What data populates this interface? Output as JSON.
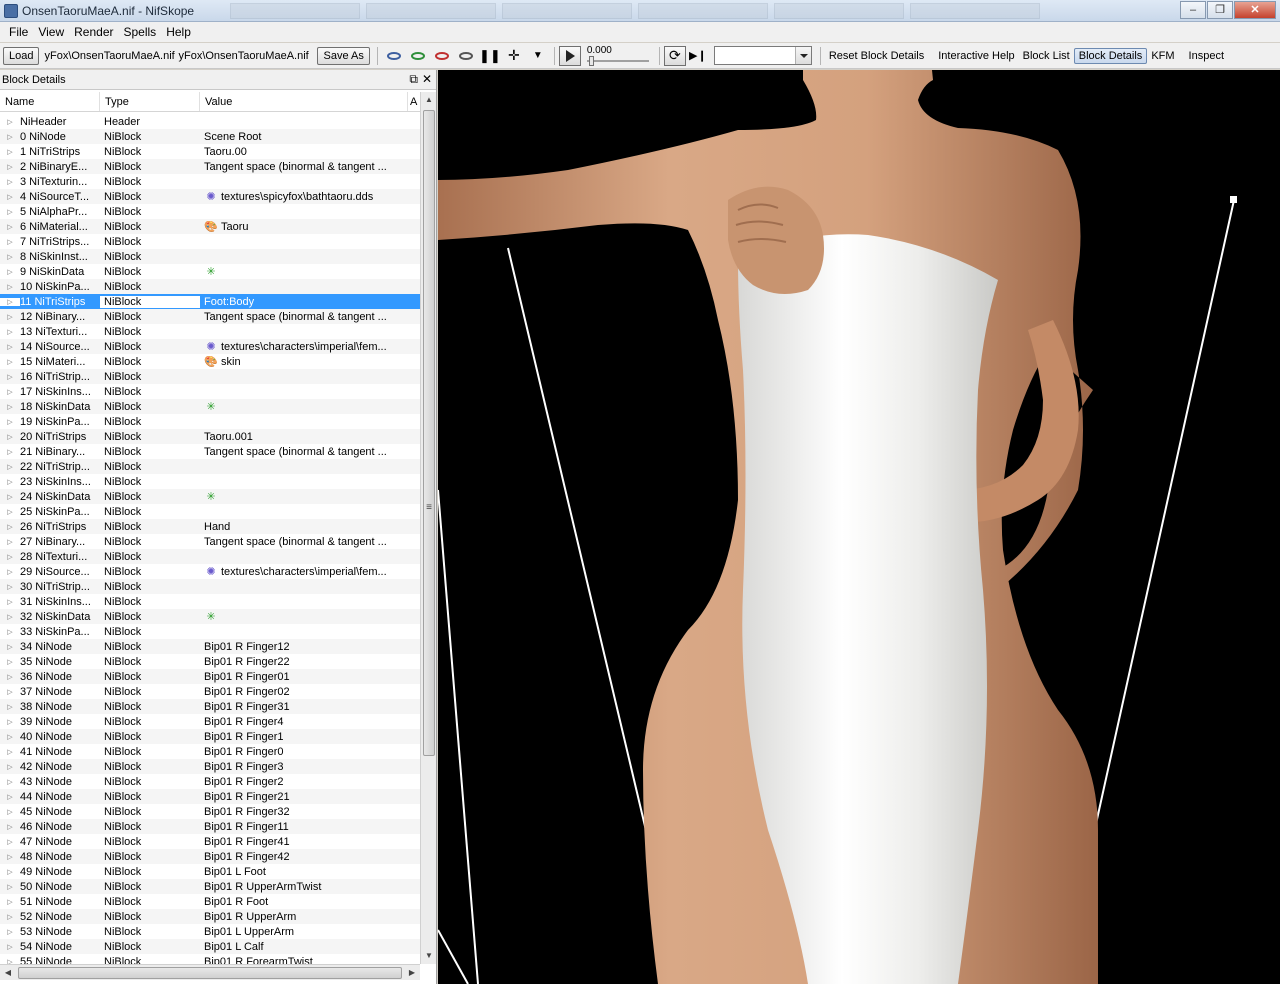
{
  "window": {
    "title": "OnsenTaoruMaeA.nif - NifSkope"
  },
  "menu": [
    "File",
    "View",
    "Render",
    "Spells",
    "Help"
  ],
  "toolbar": {
    "load": "Load",
    "load_path": "yFox\\OnsenTaoruMaeA.nif",
    "save_path": "yFox\\OnsenTaoruMaeA.nif",
    "save_as": "Save As",
    "time": "0.000",
    "combo_value": "",
    "reset": "Reset Block Details",
    "interactive_help": "Interactive Help",
    "block_list": "Block List",
    "block_details": "Block Details",
    "kfm": "KFM",
    "inspect": "Inspect"
  },
  "panel": {
    "title": "Block Details",
    "columns": [
      "Name",
      "Type",
      "Value"
    ],
    "rows": [
      {
        "name": "NiHeader",
        "type": "Header",
        "value": "",
        "icon": ""
      },
      {
        "name": "0 NiNode",
        "type": "NiBlock",
        "value": "Scene Root",
        "icon": ""
      },
      {
        "name": "1 NiTriStrips",
        "type": "NiBlock",
        "value": "Taoru.00",
        "icon": ""
      },
      {
        "name": "2 NiBinaryE...",
        "type": "NiBlock",
        "value": "Tangent space (binormal & tangent ...",
        "icon": ""
      },
      {
        "name": "3 NiTexturin...",
        "type": "NiBlock",
        "value": "",
        "icon": ""
      },
      {
        "name": "4 NiSourceT...",
        "type": "NiBlock",
        "value": "textures\\spicyfox\\bathtaoru.dds",
        "icon": "texture"
      },
      {
        "name": "5 NiAlphaPr...",
        "type": "NiBlock",
        "value": "",
        "icon": ""
      },
      {
        "name": "6 NiMaterial...",
        "type": "NiBlock",
        "value": "Taoru",
        "icon": "material"
      },
      {
        "name": "7 NiTriStrips...",
        "type": "NiBlock",
        "value": "",
        "icon": ""
      },
      {
        "name": "8 NiSkinInst...",
        "type": "NiBlock",
        "value": "",
        "icon": ""
      },
      {
        "name": "9 NiSkinData",
        "type": "NiBlock",
        "value": "",
        "icon": "skin"
      },
      {
        "name": "10 NiSkinPa...",
        "type": "NiBlock",
        "value": "",
        "icon": ""
      },
      {
        "name": "11 NiTriStrips",
        "type": "NiBlock",
        "value": "Foot:Body",
        "icon": "",
        "selected": true
      },
      {
        "name": "12 NiBinary...",
        "type": "NiBlock",
        "value": "Tangent space (binormal & tangent ...",
        "icon": ""
      },
      {
        "name": "13 NiTexturi...",
        "type": "NiBlock",
        "value": "",
        "icon": ""
      },
      {
        "name": "14 NiSource...",
        "type": "NiBlock",
        "value": "textures\\characters\\imperial\\fem...",
        "icon": "texture"
      },
      {
        "name": "15 NiMateri...",
        "type": "NiBlock",
        "value": "skin",
        "icon": "material"
      },
      {
        "name": "16 NiTriStrip...",
        "type": "NiBlock",
        "value": "",
        "icon": ""
      },
      {
        "name": "17 NiSkinIns...",
        "type": "NiBlock",
        "value": "",
        "icon": ""
      },
      {
        "name": "18 NiSkinData",
        "type": "NiBlock",
        "value": "",
        "icon": "skin"
      },
      {
        "name": "19 NiSkinPa...",
        "type": "NiBlock",
        "value": "",
        "icon": ""
      },
      {
        "name": "20 NiTriStrips",
        "type": "NiBlock",
        "value": "Taoru.001",
        "icon": ""
      },
      {
        "name": "21 NiBinary...",
        "type": "NiBlock",
        "value": "Tangent space (binormal & tangent ...",
        "icon": ""
      },
      {
        "name": "22 NiTriStrip...",
        "type": "NiBlock",
        "value": "",
        "icon": ""
      },
      {
        "name": "23 NiSkinIns...",
        "type": "NiBlock",
        "value": "",
        "icon": ""
      },
      {
        "name": "24 NiSkinData",
        "type": "NiBlock",
        "value": "",
        "icon": "skin"
      },
      {
        "name": "25 NiSkinPa...",
        "type": "NiBlock",
        "value": "",
        "icon": ""
      },
      {
        "name": "26 NiTriStrips",
        "type": "NiBlock",
        "value": "Hand",
        "icon": ""
      },
      {
        "name": "27 NiBinary...",
        "type": "NiBlock",
        "value": "Tangent space (binormal & tangent ...",
        "icon": ""
      },
      {
        "name": "28 NiTexturi...",
        "type": "NiBlock",
        "value": "",
        "icon": ""
      },
      {
        "name": "29 NiSource...",
        "type": "NiBlock",
        "value": "textures\\characters\\imperial\\fem...",
        "icon": "texture"
      },
      {
        "name": "30 NiTriStrip...",
        "type": "NiBlock",
        "value": "",
        "icon": ""
      },
      {
        "name": "31 NiSkinIns...",
        "type": "NiBlock",
        "value": "",
        "icon": ""
      },
      {
        "name": "32 NiSkinData",
        "type": "NiBlock",
        "value": "",
        "icon": "skin"
      },
      {
        "name": "33 NiSkinPa...",
        "type": "NiBlock",
        "value": "",
        "icon": ""
      },
      {
        "name": "34 NiNode",
        "type": "NiBlock",
        "value": "Bip01 R Finger12",
        "icon": ""
      },
      {
        "name": "35 NiNode",
        "type": "NiBlock",
        "value": "Bip01 R Finger22",
        "icon": ""
      },
      {
        "name": "36 NiNode",
        "type": "NiBlock",
        "value": "Bip01 R Finger01",
        "icon": ""
      },
      {
        "name": "37 NiNode",
        "type": "NiBlock",
        "value": "Bip01 R Finger02",
        "icon": ""
      },
      {
        "name": "38 NiNode",
        "type": "NiBlock",
        "value": "Bip01 R Finger31",
        "icon": ""
      },
      {
        "name": "39 NiNode",
        "type": "NiBlock",
        "value": "Bip01 R Finger4",
        "icon": ""
      },
      {
        "name": "40 NiNode",
        "type": "NiBlock",
        "value": "Bip01 R Finger1",
        "icon": ""
      },
      {
        "name": "41 NiNode",
        "type": "NiBlock",
        "value": "Bip01 R Finger0",
        "icon": ""
      },
      {
        "name": "42 NiNode",
        "type": "NiBlock",
        "value": "Bip01 R Finger3",
        "icon": ""
      },
      {
        "name": "43 NiNode",
        "type": "NiBlock",
        "value": "Bip01 R Finger2",
        "icon": ""
      },
      {
        "name": "44 NiNode",
        "type": "NiBlock",
        "value": "Bip01 R Finger21",
        "icon": ""
      },
      {
        "name": "45 NiNode",
        "type": "NiBlock",
        "value": "Bip01 R Finger32",
        "icon": ""
      },
      {
        "name": "46 NiNode",
        "type": "NiBlock",
        "value": "Bip01 R Finger11",
        "icon": ""
      },
      {
        "name": "47 NiNode",
        "type": "NiBlock",
        "value": "Bip01 R Finger41",
        "icon": ""
      },
      {
        "name": "48 NiNode",
        "type": "NiBlock",
        "value": "Bip01 R Finger42",
        "icon": ""
      },
      {
        "name": "49 NiNode",
        "type": "NiBlock",
        "value": "Bip01 L Foot",
        "icon": ""
      },
      {
        "name": "50 NiNode",
        "type": "NiBlock",
        "value": "Bip01 R UpperArmTwist",
        "icon": ""
      },
      {
        "name": "51 NiNode",
        "type": "NiBlock",
        "value": "Bip01 R Foot",
        "icon": ""
      },
      {
        "name": "52 NiNode",
        "type": "NiBlock",
        "value": "Bip01 R UpperArm",
        "icon": ""
      },
      {
        "name": "53 NiNode",
        "type": "NiBlock",
        "value": "Bip01 L UpperArm",
        "icon": ""
      },
      {
        "name": "54 NiNode",
        "type": "NiBlock",
        "value": "Bip01 L Calf",
        "icon": ""
      },
      {
        "name": "55 NiNode",
        "type": "NiBlock",
        "value": "Bip01 R ForearmTwist",
        "icon": ""
      }
    ]
  },
  "colors": {
    "selection": "#3399ff",
    "viewport_bg": "#000000",
    "skin": "#c89470",
    "towel": "#f2f2f0"
  }
}
